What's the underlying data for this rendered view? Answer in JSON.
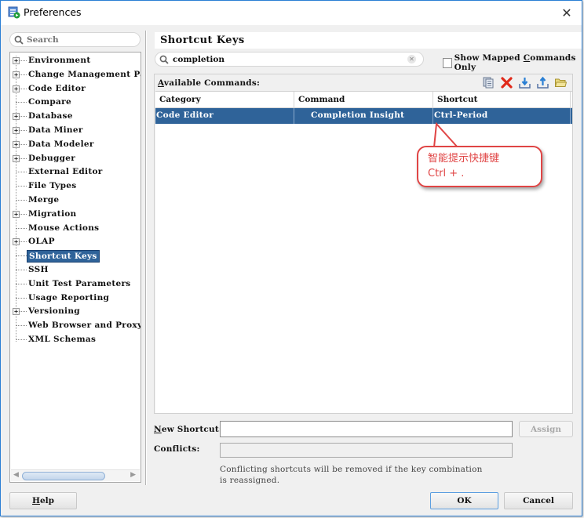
{
  "window": {
    "title": "Preferences",
    "close_glyph": "✕"
  },
  "left": {
    "search_placeholder": "Search",
    "tree": [
      {
        "label": "Environment",
        "expandable": true
      },
      {
        "label": "Change Management Parame",
        "expandable": true
      },
      {
        "label": "Code Editor",
        "expandable": true
      },
      {
        "label": "Compare",
        "expandable": false
      },
      {
        "label": "Database",
        "expandable": true
      },
      {
        "label": "Data Miner",
        "expandable": true
      },
      {
        "label": "Data Modeler",
        "expandable": true
      },
      {
        "label": "Debugger",
        "expandable": true
      },
      {
        "label": "External Editor",
        "expandable": false
      },
      {
        "label": "File Types",
        "expandable": false
      },
      {
        "label": "Merge",
        "expandable": false
      },
      {
        "label": "Migration",
        "expandable": true
      },
      {
        "label": "Mouse Actions",
        "expandable": false
      },
      {
        "label": "OLAP",
        "expandable": true
      },
      {
        "label": "Shortcut Keys",
        "expandable": false,
        "selected": true
      },
      {
        "label": "SSH",
        "expandable": false
      },
      {
        "label": "Unit Test Parameters",
        "expandable": false
      },
      {
        "label": "Usage Reporting",
        "expandable": false
      },
      {
        "label": "Versioning",
        "expandable": true
      },
      {
        "label": "Web Browser and Proxy",
        "expandable": false
      },
      {
        "label": "XML Schemas",
        "expandable": false
      }
    ]
  },
  "main": {
    "title": "Shortcut Keys",
    "filter_value": "completion",
    "show_mapped_label_pre": "Show Mapped ",
    "show_mapped_label_u": "C",
    "show_mapped_label_post": "ommands Only",
    "show_mapped_checked": false,
    "available_label_u": "A",
    "available_label_rest": "vailable Commands:",
    "toolbar_icons": [
      "copy-icon",
      "delete-icon",
      "import-icon",
      "export-icon",
      "open-folder-icon"
    ],
    "table": {
      "headers": [
        "Category",
        "Command",
        "Shortcut"
      ],
      "rows": [
        {
          "category": "Code Editor",
          "command": "Completion Insight",
          "shortcut": "Ctrl-Period",
          "selected": true
        }
      ]
    },
    "callout": {
      "line1": "智能提示快捷键",
      "line2": "Ctrl + ."
    },
    "new_shortcut_label_u": "N",
    "new_shortcut_label_rest": "ew Shortcut:",
    "new_shortcut_value": "",
    "assign_label": "Assign",
    "conflicts_label": "Conflicts:",
    "conflicts_value": "",
    "note_line1": "Conflicting shortcuts will be removed if the key combination",
    "note_line2": "is reassigned."
  },
  "footer": {
    "help_u": "H",
    "help_rest": "elp",
    "ok_label": "OK",
    "cancel_label": "Cancel"
  },
  "colors": {
    "selection": "#2f6399",
    "callout": "#e04545",
    "window_border": "#2b7fd4"
  }
}
